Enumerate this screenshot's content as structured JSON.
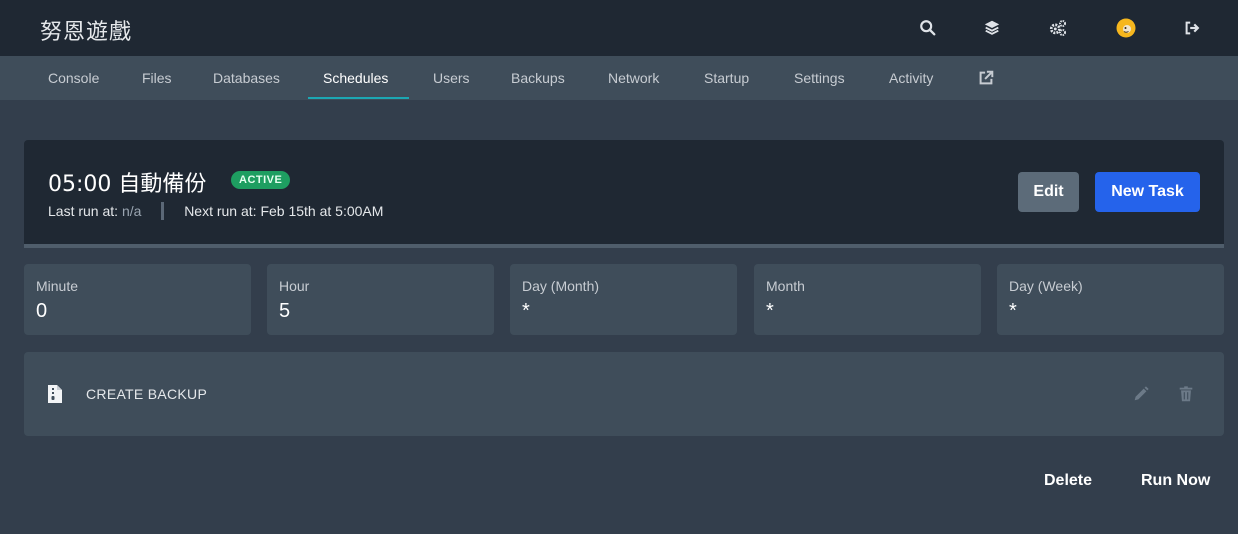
{
  "header": {
    "brand": "努恩遊戲",
    "icons": [
      "search-icon",
      "layers-icon",
      "cogs-icon",
      "avatar",
      "logout-icon"
    ]
  },
  "nav": {
    "tabs": [
      {
        "label": "Console"
      },
      {
        "label": "Files"
      },
      {
        "label": "Databases"
      },
      {
        "label": "Schedules",
        "active": true
      },
      {
        "label": "Users"
      },
      {
        "label": "Backups"
      },
      {
        "label": "Network"
      },
      {
        "label": "Startup"
      },
      {
        "label": "Settings"
      },
      {
        "label": "Activity"
      }
    ],
    "external_icon": "external-link-icon"
  },
  "schedule": {
    "title": "05:00 自動備份",
    "status": "ACTIVE",
    "last_run_label": "Last run at:",
    "last_run_value": "n/a",
    "next_run_label": "Next run at:",
    "next_run_value": "Feb 15th at 5:00AM",
    "edit_label": "Edit",
    "new_task_label": "New Task",
    "cron": [
      {
        "label": "Minute",
        "value": "0"
      },
      {
        "label": "Hour",
        "value": "5"
      },
      {
        "label": "Day (Month)",
        "value": "*"
      },
      {
        "label": "Month",
        "value": "*"
      },
      {
        "label": "Day (Week)",
        "value": "*"
      }
    ]
  },
  "tasks": [
    {
      "icon": "file-archive-icon",
      "label": "CREATE BACKUP"
    }
  ],
  "footer": {
    "delete_label": "Delete",
    "run_now_label": "Run Now"
  },
  "colors": {
    "accent": "#1ca7b3",
    "primary_button": "#2563eb",
    "active_badge": "#1e9e61"
  }
}
